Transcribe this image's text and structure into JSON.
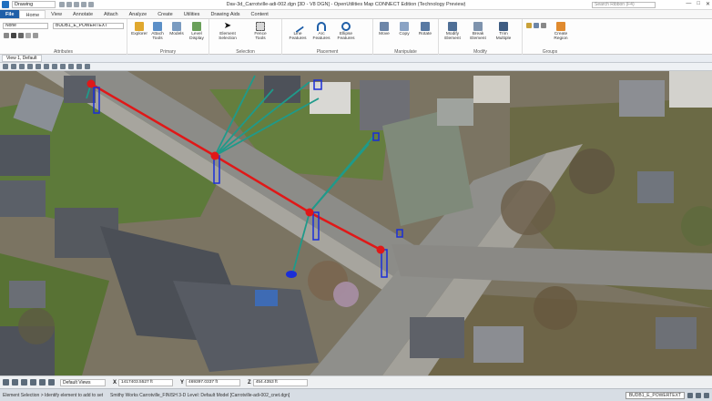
{
  "titlebar": {
    "workflow": "Drawing",
    "title": "Dav-3d_Carrotville-adi-002.dgn [3D - V8 DGN] - OpenUtilities Map CONNECT Edition (Technology Preview)",
    "search_placeholder": "Search Ribbon (F4)",
    "window_buttons": [
      "—",
      "□",
      "✕"
    ]
  },
  "tabs": [
    "File",
    "Home",
    "View",
    "Annotate",
    "Attach",
    "Analyze",
    "Create",
    "Utilities",
    "Drawing Aids",
    "Content"
  ],
  "ribbon": {
    "attributes": {
      "label": "Attributes",
      "combo1": "None",
      "combo2": "BUDB1_E_POWERTEXT"
    },
    "primary": {
      "label": "Primary",
      "buttons": [
        "Explorer",
        "Attach Tools",
        "Models",
        "Level Display"
      ]
    },
    "selection": {
      "label": "Selection",
      "buttons": [
        "Element Selection",
        "Fence Tools"
      ]
    },
    "placement": {
      "label": "Placement",
      "buttons": [
        "Line Features",
        "Arc Features",
        "Ellipse Features"
      ]
    },
    "manipulate": {
      "label": "Manipulate",
      "buttons": [
        "Move",
        "Copy",
        "Rotate"
      ]
    },
    "modify": {
      "label": "Modify",
      "buttons": [
        "Modify Element",
        "Break Element",
        "Trim Multiple"
      ]
    },
    "groups": {
      "label": "Groups",
      "buttons": [
        "Create Region"
      ]
    }
  },
  "view": {
    "tab_label": "View 1, Default"
  },
  "bottombar": {
    "views": "Default Views",
    "coords": [
      {
        "axis": "X",
        "value": "1417403.5527 ft"
      },
      {
        "axis": "Y",
        "value": "469397.0337 ft"
      },
      {
        "axis": "Z",
        "value": "454.4353 ft"
      }
    ]
  },
  "statusbar": {
    "prompt": "Element Selection > Identify element to add to set",
    "file": "Smithy Works Carrotville_FINISH 3-D Level: Default Model [Carrotville-adi-002_cnet.dgn]",
    "level": "BUDB1_E_POWERTEXT"
  },
  "colors": {
    "accent": "#1f5fa8",
    "powerline": "#e01818",
    "services": "#1f9a8a",
    "poles": "#1a2ed8"
  }
}
